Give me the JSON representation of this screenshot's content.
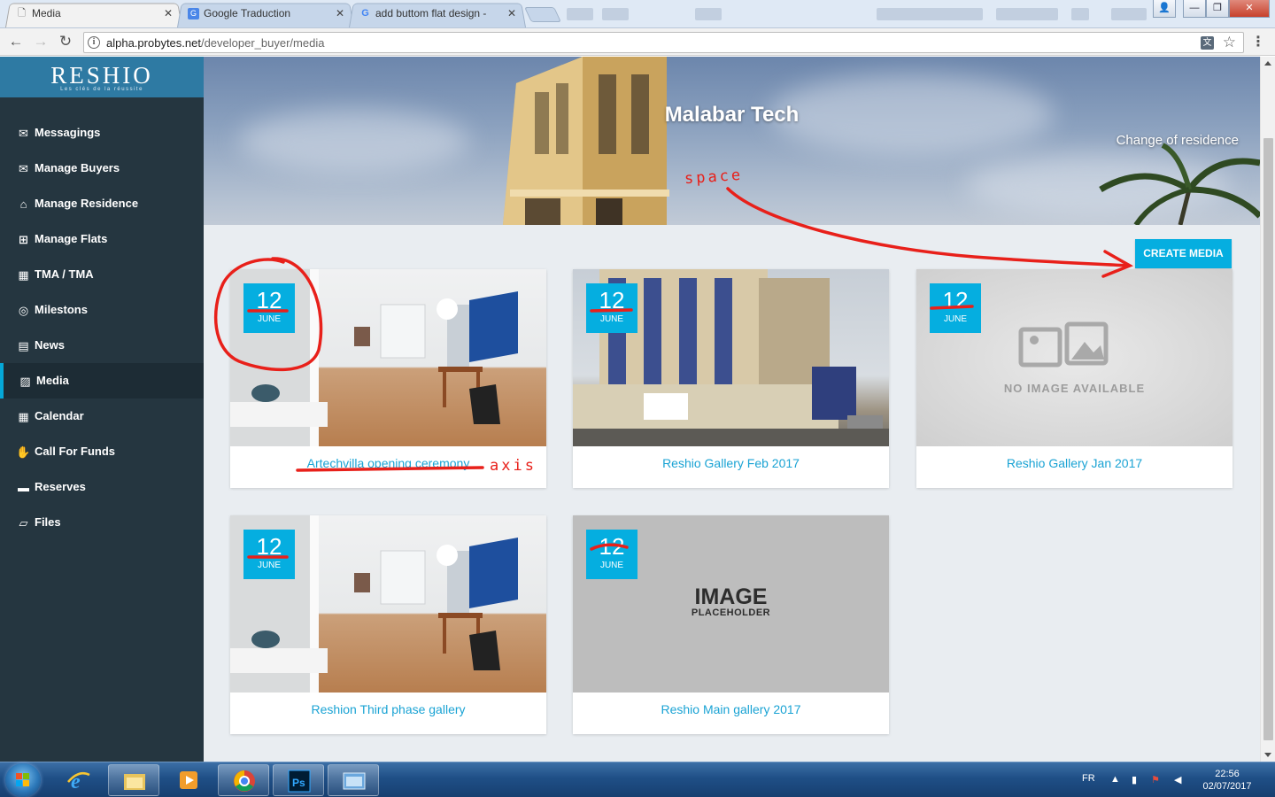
{
  "browser": {
    "tabs": [
      {
        "label": "Media",
        "icon": "page-icon",
        "active": true
      },
      {
        "label": "Google Traduction",
        "icon": "google-translate-icon",
        "active": false
      },
      {
        "label": "add buttom flat design -",
        "icon": "google-icon",
        "active": false
      }
    ],
    "url_host": "alpha.probytes.net",
    "url_path": "/developer_buyer/media"
  },
  "sidebar": {
    "brand": "RESHIO",
    "tagline": "Les clés de la réussite",
    "items": [
      {
        "label": "Messagings",
        "icon": "envelope-icon"
      },
      {
        "label": "Manage Buyers",
        "icon": "envelope-icon"
      },
      {
        "label": "Manage Residence",
        "icon": "bank-icon"
      },
      {
        "label": "Manage Flats",
        "icon": "grid-icon"
      },
      {
        "label": "TMA / TMA",
        "icon": "building-icon"
      },
      {
        "label": "Milestons",
        "icon": "target-icon"
      },
      {
        "label": "News",
        "icon": "newspaper-icon"
      },
      {
        "label": "Media",
        "icon": "image-icon",
        "active": true
      },
      {
        "label": "Calendar",
        "icon": "calendar-icon"
      },
      {
        "label": "Call For Funds",
        "icon": "handshake-icon"
      },
      {
        "label": "Reserves",
        "icon": "card-icon"
      },
      {
        "label": "Files",
        "icon": "folder-open-icon"
      }
    ]
  },
  "hero": {
    "title": "Malabar Tech",
    "subtitle": "Change of residence"
  },
  "actions": {
    "create_media": "CREATE MEDIA"
  },
  "cards": [
    {
      "title": "Artechvilla opening ceremony",
      "day": "12",
      "month": "JUNE",
      "image": "room"
    },
    {
      "title": "Reshio Gallery Feb 2017",
      "day": "12",
      "month": "JUNE",
      "image": "tower"
    },
    {
      "title": "Reshio Gallery Jan 2017",
      "day": "12",
      "month": "JUNE",
      "image": "no-image"
    },
    {
      "title": "Reshion Third phase gallery",
      "day": "12",
      "month": "JUNE",
      "image": "room"
    },
    {
      "title": "Reshio Main gallery 2017",
      "day": "12",
      "month": "JUNE",
      "image": "placeholder"
    }
  ],
  "placeholders": {
    "no_image": "NO IMAGE AVAILABLE",
    "image_placeholder_line1": "IMAGE",
    "image_placeholder_line2": "PLACEHOLDER"
  },
  "annotations": {
    "space": "space",
    "axis": "axis",
    "color": "#e8201a"
  },
  "taskbar": {
    "language": "FR",
    "time": "22:56",
    "date": "02/07/2017"
  }
}
